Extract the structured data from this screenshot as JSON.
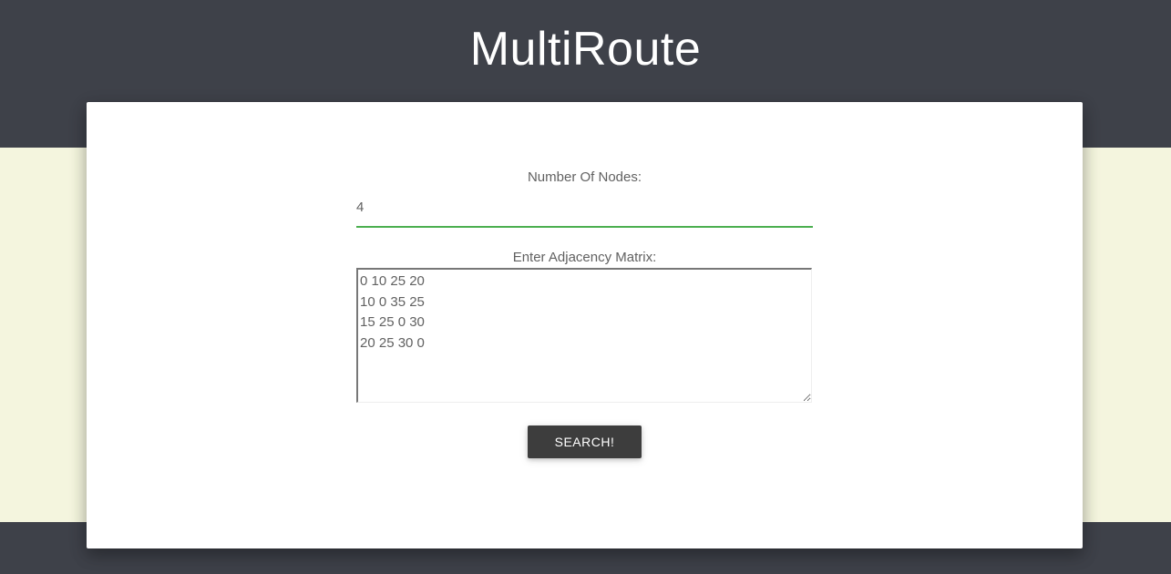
{
  "header": {
    "title": "MultiRoute"
  },
  "form": {
    "nodes_label": "Number Of Nodes:",
    "nodes_value": "4",
    "matrix_label": "Enter Adjacency Matrix:",
    "matrix_value": "0 10 25 20\n10 0 35 25\n15 25 0 30\n20 25 30 0",
    "search_label": "Search!"
  },
  "colors": {
    "header_background": "#3e4149",
    "page_background": "#f4f5de",
    "input_underline": "#4caf50",
    "button_background": "#3d3d3d"
  }
}
